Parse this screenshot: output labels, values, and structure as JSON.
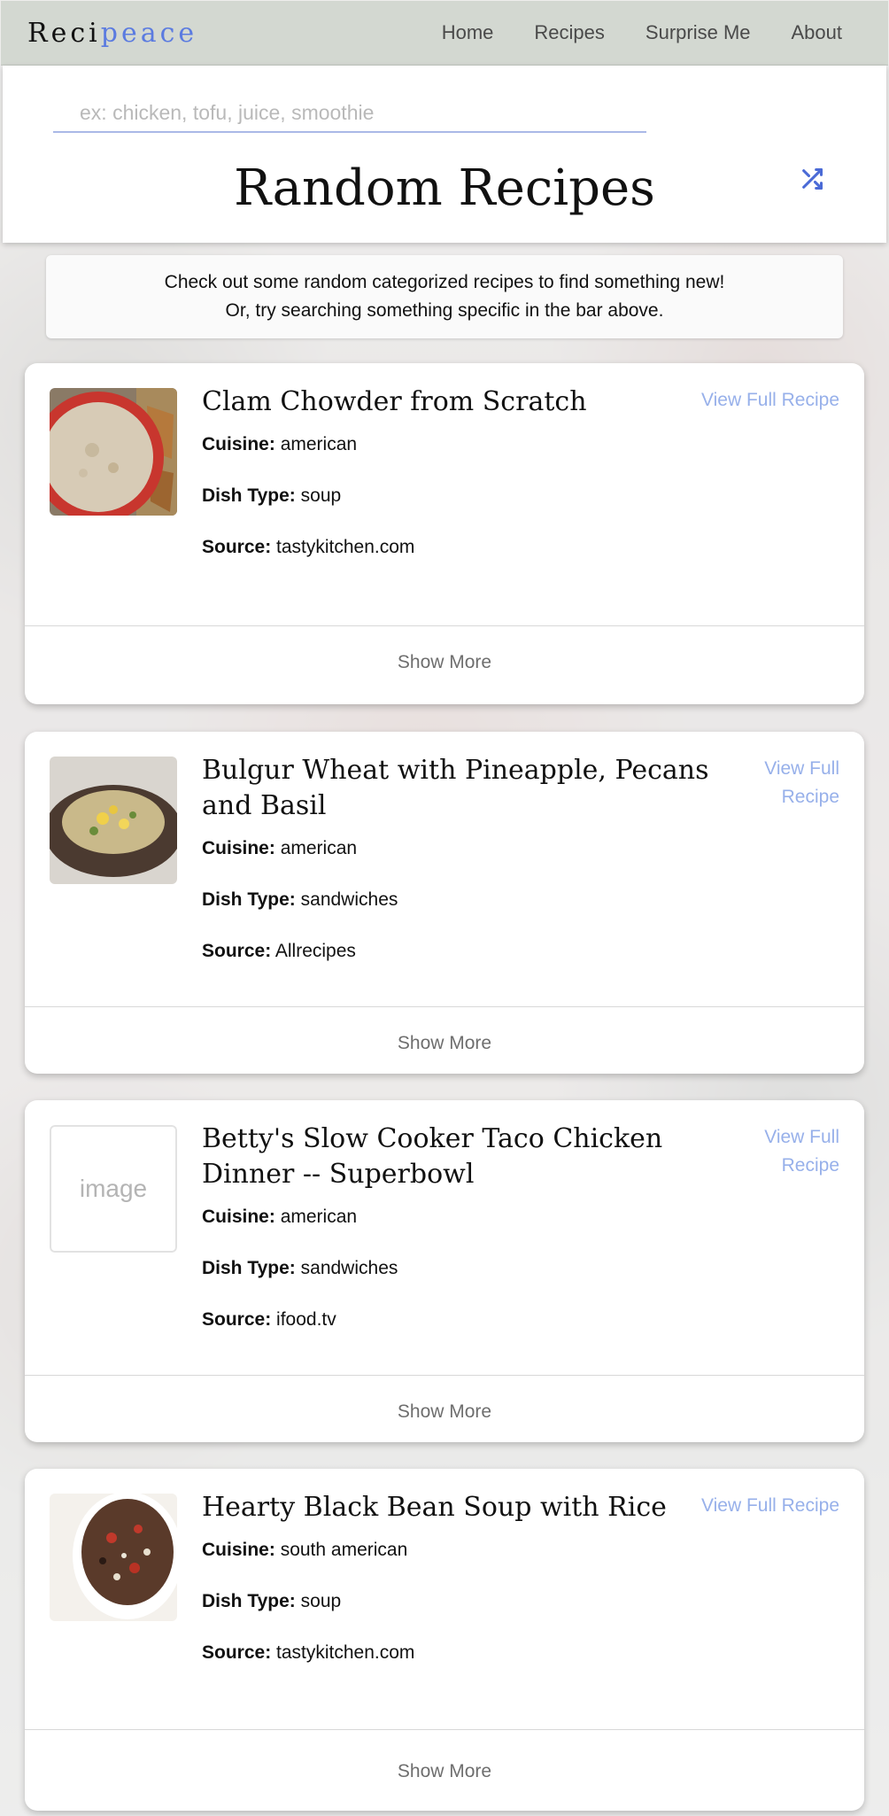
{
  "brand": {
    "main": "Reci",
    "accent": "peace"
  },
  "nav": {
    "items": [
      "Home",
      "Recipes",
      "Surprise Me",
      "About"
    ]
  },
  "search": {
    "placeholder": "ex: chicken, tofu, juice, smoothie",
    "value": ""
  },
  "shuffle_icon": "shuffle-icon",
  "page_title": "Random Recipes",
  "intro": {
    "line1": "Check out some random categorized recipes to find something new!",
    "line2": "Or, try searching something specific in the bar above."
  },
  "labels": {
    "cuisine": "Cuisine:",
    "dish_type": "Dish Type:",
    "source": "Source:",
    "view_full": "View Full Recipe",
    "show_more": "Show More",
    "image_placeholder": "image"
  },
  "recipes": [
    {
      "title": "Clam Chowder from Scratch",
      "cuisine": "american",
      "dish_type": "soup",
      "source": "tastykitchen.com"
    },
    {
      "title": "Bulgur Wheat with Pineapple, Pecans and Basil",
      "cuisine": "american",
      "dish_type": "sandwiches",
      "source": "Allrecipes"
    },
    {
      "title": "Betty's Slow Cooker Taco Chicken Dinner -- Superbowl",
      "cuisine": "american",
      "dish_type": "sandwiches",
      "source": "ifood.tv"
    },
    {
      "title": "Hearty Black Bean Soup with Rice",
      "cuisine": "south american",
      "dish_type": "soup",
      "source": "tastykitchen.com"
    }
  ],
  "colors": {
    "accent": "#5b7be0",
    "link": "#97b0ea",
    "navbar": "#d3d8d1"
  }
}
